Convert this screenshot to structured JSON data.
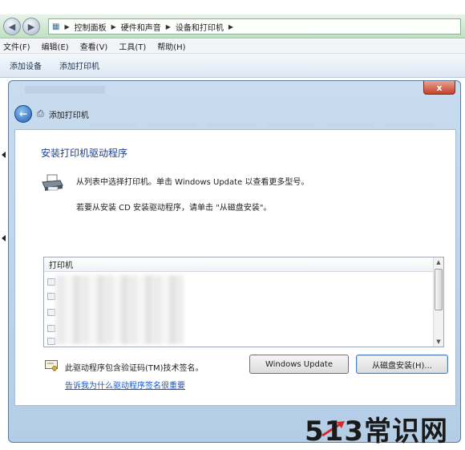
{
  "explorer": {
    "breadcrumb": [
      "控制面板",
      "硬件和声音",
      "设备和打印机"
    ],
    "menu": [
      "文件(F)",
      "编辑(E)",
      "查看(V)",
      "工具(T)",
      "帮助(H)"
    ],
    "commands": [
      "添加设备",
      "添加打印机"
    ]
  },
  "dialog": {
    "close_label": "x",
    "title": "添加打印机",
    "heading": "安装打印机驱动程序",
    "description_1": "从列表中选择打印机。单击 Windows Update 以查看更多型号。",
    "description_2": "若要从安装 CD 安装驱动程序，请单击 \"从磁盘安装\"。",
    "list": {
      "column_header": "打印机"
    },
    "signature_text": "此驱动程序包含验证码(TM)技术签名。",
    "signature_link": "告诉我为什么驱动程序签名很重要",
    "buttons": {
      "windows_update": "Windows Update",
      "from_disk": "从磁盘安装(H)..."
    }
  },
  "watermark": "513常识网",
  "icons": {
    "back": "back-arrow-icon",
    "forward": "forward-arrow-icon",
    "printer": "printer-icon",
    "certificate": "certificate-icon"
  }
}
